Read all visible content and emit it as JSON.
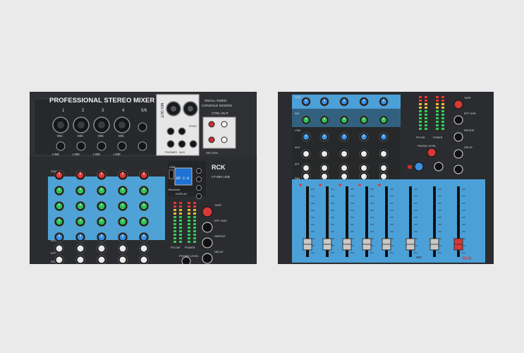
{
  "left_mixer": {
    "title": "PROFESSIONAL STEREO MIXER",
    "channels": [
      "1",
      "2",
      "3",
      "4",
      "5/6"
    ],
    "input_labels": [
      "LINE",
      "LINE",
      "LINE",
      "LINE"
    ],
    "mic_labels": [
      "MIC",
      "MIC",
      "MIC",
      "MIC"
    ],
    "mix_out": "MIX OUT",
    "subtitle_line1": "SMALL-SIZED",
    "subtitle_line2": "CONSOLE MIXERS",
    "ctrl_out": "CTRL OUT",
    "jack_labels": [
      "PHONES",
      "AUX",
      "RETURN"
    ],
    "sync": "SYNC",
    "brand": "RCK",
    "model": "CT-80S USB",
    "display_label": "DISPLAY",
    "lcd_text": "EP 2.0",
    "bluetooth": "Bluetooth",
    "usb": "USB",
    "fx_labels": [
      "TAPE",
      "EFF 2090",
      "REPEAT",
      "DELAY"
    ],
    "meter_labels": [
      "FFLOW",
      "POWER"
    ],
    "phone_level": "PHONE LEVEL",
    "strip_labels": [
      "GAIN",
      "AUX",
      "EFF",
      "PAN"
    ]
  },
  "right_mixer": {
    "strip_labels": [
      "HIGH",
      "MID",
      "LOW",
      "AUX",
      "EFF",
      "PAN"
    ],
    "fx_labels": [
      "TAPE",
      "EFF 2090",
      "REPEAT",
      "DELAY"
    ],
    "meter_labels": [
      "FFLOW",
      "POWER"
    ],
    "phone_level": "PHONE LEVEL",
    "fader_labels": [
      "1",
      "2",
      "3",
      "4",
      "5",
      "6",
      "7",
      "8"
    ],
    "mix_label": "MIX",
    "brand": "RCK"
  },
  "colors": {
    "background": "#eaeaea",
    "panel": "#2b2d30",
    "blue_strip": "#4a9fd8",
    "knob_green": "#2fbf57",
    "knob_blue": "#3a8fe0",
    "knob_red": "#d73a3a",
    "knob_white": "#e8e8e8"
  }
}
